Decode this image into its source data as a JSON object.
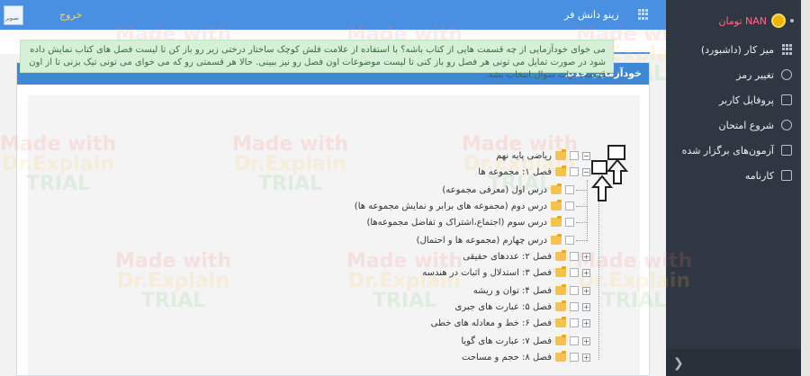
{
  "topbar": {
    "brand": "زینو دانش فر",
    "logout": "خروج",
    "avatar_alt": "تصویر"
  },
  "sidebar": {
    "user_name": "NAN تومان",
    "items": [
      {
        "label": "میز کار (داشبورد)",
        "icon": "dashboard-grid-icon"
      },
      {
        "label": "تغییر رمز",
        "icon": "gear-icon"
      },
      {
        "label": "پروفایل کاربر",
        "icon": "user-icon"
      },
      {
        "label": "شروع امتحان",
        "icon": "play-icon"
      },
      {
        "label": "آزمون‌های برگزار شده",
        "icon": "folder-icon"
      },
      {
        "label": "کارنامه",
        "icon": "document-icon"
      }
    ],
    "collapse_glyph": "❯"
  },
  "panel": {
    "title": "خودآزمایی جدید",
    "alert": "می خوای خودآزمایی از چه قسمت هایی از کتاب باشه؟ با استفاده از علامت فلش کوچک ساختار درختی زیر رو باز کن تا لیست فصل های کتاب نمایش داده شود در صورت تمایل می تونی هر فصل رو باز کنی تا لیست موضوعات اون فصل رو نیز ببینی. حالا هر قسمتی رو که می خوای می تونی تیک بزنی تا از اون قسمت برات سوال انتخاب بشه."
  },
  "tree": {
    "root": "ریاضی پایه نهم",
    "chapter1": "فصل ۱: مجموعه ها",
    "lessons": [
      "درس اول (معرفی مجموعه)",
      "درس دوم (مجموعه های برابر و نمایش مجموعه ها)",
      "درس سوم (اجتماع،اشتراک و تفاضل مجموعه‌ها)",
      "درس چهارم (مجموعه ها و احتمال)"
    ],
    "chapters": [
      "فصل ۲: عددهای حقیقی",
      "فصل ۳: استدلال و اثبات در هندسه",
      "فصل ۴: توان و ریشه",
      "فصل ۵: عبارت های جبری",
      "فصل ۶: خط و معادله های خطی",
      "فصل ۷: عبارت های گویا",
      "فصل ۸: حجم و مساحت"
    ],
    "toggle_collapsed": "+",
    "toggle_expanded": "−"
  },
  "watermark": {
    "line1": "Made with",
    "line2": "Dr.Explain",
    "line3": "TRIAL"
  },
  "colors": {
    "topbar": "#4a90e2",
    "sidebar": "#2f3742",
    "panel_header": "#3d87d6",
    "alert_bg": "#d6f0d8",
    "user_name": "#ff6b8a",
    "logout": "#ffd54a"
  }
}
